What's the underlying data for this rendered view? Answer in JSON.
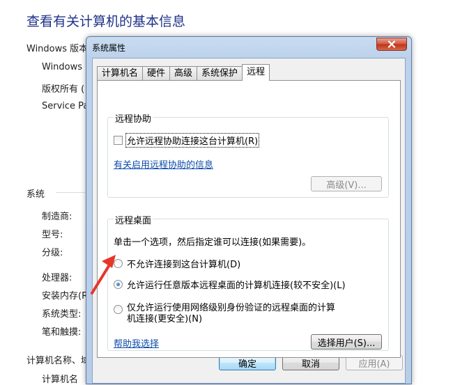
{
  "background": {
    "title": "查看有关计算机的基本信息",
    "windows_edition_heading": "Windows 版本",
    "windows_edition_items": [
      "Windows",
      "版权所有 (",
      "Service Pa"
    ],
    "system_heading": "系统",
    "system_items": [
      "制造商:",
      "型号:",
      "分级:",
      "处理器:",
      "安装内存(R",
      "系统类型:",
      "笔和触摸:"
    ],
    "computer_name_heading": "计算机名称、域",
    "computer_name_items": [
      "计算机名"
    ]
  },
  "dialog": {
    "title": "系统属性",
    "tabs": [
      {
        "label": "计算机名",
        "active": false
      },
      {
        "label": "硬件",
        "active": false
      },
      {
        "label": "高级",
        "active": false
      },
      {
        "label": "系统保护",
        "active": false
      },
      {
        "label": "远程",
        "active": true
      }
    ],
    "remote_assistance": {
      "legend": "远程协助",
      "checkbox_label": "允许远程协助连接这台计算机(R)",
      "checked": false,
      "info_link": "有关启用远程协助的信息",
      "advanced_button": "高级(V)..."
    },
    "remote_desktop": {
      "legend": "远程桌面",
      "instruction": "单击一个选项，然后指定谁可以连接(如果需要)。",
      "options": [
        {
          "label": "不允许连接到这台计算机(D)",
          "checked": false
        },
        {
          "label": "允许运行任意版本远程桌面的计算机连接(较不安全)(L)",
          "checked": true
        },
        {
          "label_line1": "仅允许运行使用网络级别身份验证的远程桌面的计算",
          "label_line2": "机连接(更安全)(N)",
          "checked": false
        }
      ],
      "help_link": "帮助我选择",
      "select_users_button": "选择用户(S)..."
    },
    "ok_button": "确定",
    "cancel_button": "取消",
    "apply_button": "应用(A)"
  },
  "colors": {
    "accent_arrow": "#e8352a",
    "link": "#0c4ba8",
    "title_blue": "#1e3287"
  }
}
